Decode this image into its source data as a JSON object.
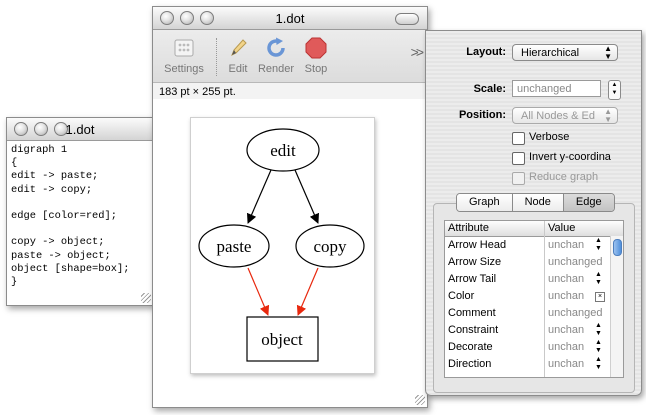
{
  "text_window": {
    "title": "1.dot",
    "code": "digraph 1\n{\nedit -> paste;\nedit -> copy;\n\nedge [color=red];\n\ncopy -> object;\npaste -> object;\nobject [shape=box];\n}"
  },
  "graph_window": {
    "title": "1.dot",
    "toolbar": {
      "settings": "Settings",
      "edit": "Edit",
      "render": "Render",
      "stop": "Stop",
      "overflow": ">>"
    },
    "size_label": "183 pt × 255 pt.",
    "graph": {
      "nodes": [
        "edit",
        "paste",
        "copy",
        "object"
      ],
      "edge_color_default": "#000000",
      "edge_color_red": "#e8280e"
    }
  },
  "inspector": {
    "layout_label": "Layout:",
    "layout_value": "Hierarchical",
    "scale_label": "Scale:",
    "scale_placeholder": "unchanged",
    "position_label": "Position:",
    "position_value": "All Nodes & Ed",
    "verbose_label": "Verbose",
    "invert_label": "Invert y-coordina",
    "reduce_label": "Reduce graph",
    "tabs": [
      "Graph",
      "Node",
      "Edge"
    ],
    "selected_tab": "Edge",
    "table": {
      "col_attribute": "Attribute",
      "col_value": "Value",
      "rows": [
        {
          "attr": "Arrow Head",
          "value": "unchan"
        },
        {
          "attr": "Arrow Size",
          "value": "unchanged"
        },
        {
          "attr": "Arrow Tail",
          "value": "unchan"
        },
        {
          "attr": "Color",
          "value": "unchan"
        },
        {
          "attr": "Comment",
          "value": "unchanged"
        },
        {
          "attr": "Constraint",
          "value": "unchan"
        },
        {
          "attr": "Decorate",
          "value": "unchan"
        },
        {
          "attr": "Direction",
          "value": "unchan"
        }
      ]
    }
  }
}
